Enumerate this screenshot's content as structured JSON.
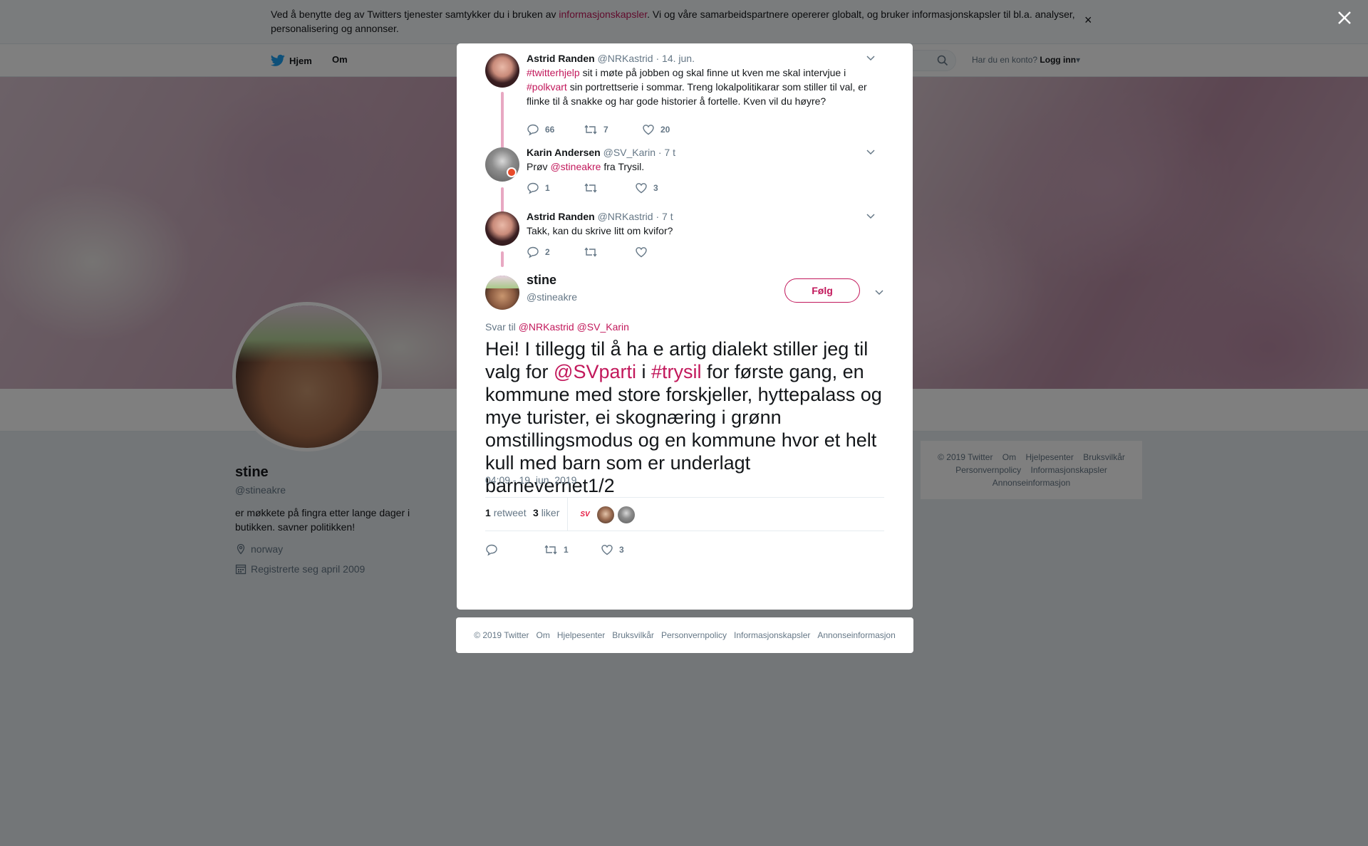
{
  "cookie_bar": {
    "text_before": "Ved å benytte deg av Twitters tjenester samtykker du i bruken av ",
    "link": "informasjonskapsler",
    "text_after": ". Vi og våre samarbeidspartnere opererer globalt, og bruker informasjonskapsler til bl.a. analyser, personalisering og annonser.",
    "close": "×"
  },
  "nav": {
    "home": "Hjem",
    "about": "Om",
    "login_prompt": "Har du en konto?",
    "login": "Logg inn"
  },
  "profile": {
    "name": "stine",
    "handle": "@stineakre",
    "bio": "er møkkete på fingra etter lange dager i butikken. savner politikken!",
    "location": "norway",
    "joined": "Registrerte seg april 2009"
  },
  "side_footer": [
    "© 2019 Twitter",
    "Om",
    "Hjelpesenter",
    "Bruksvilkår",
    "Personvernpolicy",
    "Informasjonskapsler",
    "Annonseinformasjon"
  ],
  "thread": [
    {
      "name": "Astrid Randen",
      "handle": "@NRKastrid",
      "time": "· 14. jun.",
      "hashtag1": "#twitterhjelp",
      "text1": " sit i møte på jobben og skal finne ut kven me skal intervjue i ",
      "hashtag2": "#polkvart",
      "text2": " sin portrettserie i sommar. Treng lokalpolitikarar som stiller til val, er flinke til å snakke og har gode historier å fortelle. Kven vil du høyre?",
      "replies": "66",
      "retweets": "7",
      "likes": "20"
    },
    {
      "name": "Karin Andersen",
      "handle": "@SV_Karin",
      "time": "· 7 t",
      "text_before": "Prøv ",
      "mention": "@stineakre",
      "text_after": " fra Trysil.",
      "replies": "1",
      "retweets": "",
      "likes": "3"
    },
    {
      "name": "Astrid Randen",
      "handle": "@NRKastrid",
      "time": "· 7 t",
      "text": "Takk, kan du skrive litt om kvifor?",
      "replies": "2",
      "retweets": "",
      "likes": ""
    }
  ],
  "main_tweet": {
    "name": "stine",
    "handle": "@stineakre",
    "follow": "Følg",
    "reply_to_label": "Svar til",
    "reply_to_1": "@NRKastrid",
    "reply_to_2": "@SV_Karin",
    "text_1": "Hei! I tillegg til å ha e artig dialekt stiller jeg til valg for ",
    "mention": "@SVparti",
    "text_2": " i ",
    "hashtag": "#trysil",
    "text_3": " for første gang, en kommune med store forskjeller, hyttepalass og mye turister, ei skognæring i grønn omstillingsmodus og en kommune hvor et helt kull med barn som er underlagt barnevernet1/2",
    "timestamp": "04:09 - 19. jun. 2019",
    "retweet_count": "1",
    "retweet_label": "retweet",
    "like_count": "3",
    "like_label": "liker",
    "liker_sv_logo": "SV",
    "action_retweets": "1",
    "action_likes": "3"
  },
  "modal_footer": [
    "© 2019 Twitter",
    "Om",
    "Hjelpesenter",
    "Bruksvilkår",
    "Personvernpolicy",
    "Informasjonskapsler",
    "Annonseinformasjon"
  ],
  "colors": {
    "accent": "#c2185b",
    "thread_line": "#e8a8c2",
    "muted": "#657786"
  }
}
